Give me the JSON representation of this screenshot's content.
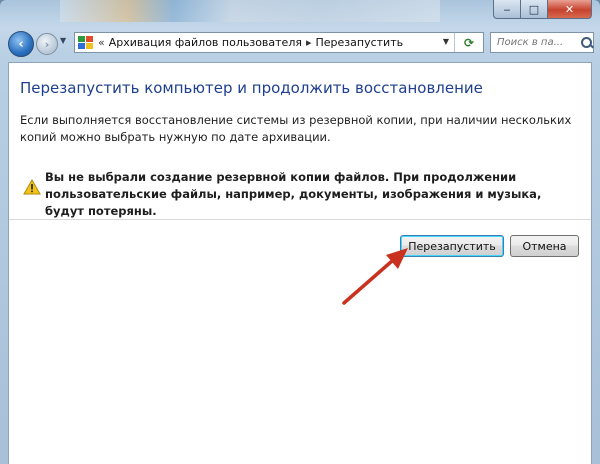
{
  "window": {
    "caption": {
      "minimize": "‒",
      "maximize": "□",
      "close": "✕"
    }
  },
  "navbar": {
    "back": "‹",
    "forward": "›",
    "breadcrumb": {
      "separator": "«",
      "items": [
        "Архивация файлов пользователя",
        "Перезапустить"
      ],
      "arrow": "▸"
    },
    "dropdown": "▼",
    "refresh": "⟳",
    "search": {
      "placeholder": "Поиск в па..."
    }
  },
  "page": {
    "title": "Перезапустить компьютер и продолжить восстановление",
    "description": "Если выполняется восстановление системы из резервной копии, при наличии нескольких копий можно выбрать нужную по дате архивации.",
    "warning": "Вы не выбрали создание резервной копии файлов. При продолжении пользовательские файлы, например, документы, изображения и музыка, будут потеряны."
  },
  "buttons": {
    "restart": "Перезапустить",
    "cancel": "Отмена"
  },
  "colors": {
    "title": "#1e3f8f",
    "arrow": "#c8321e",
    "warning_icon": "#f3c416"
  }
}
